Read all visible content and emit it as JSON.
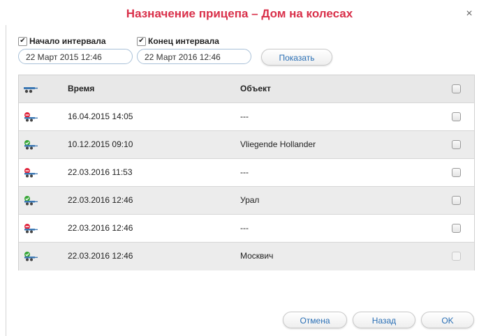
{
  "dialog": {
    "title": "Назначение прицепа – Дом на колесах",
    "close_glyph": "×"
  },
  "filters": {
    "start": {
      "label": "Начало интервала",
      "checked": true,
      "value": "22 Март 2015 12:46"
    },
    "end": {
      "label": "Конец интервала",
      "checked": true,
      "value": "22 Март 2016 12:46"
    },
    "show_label": "Показать"
  },
  "table": {
    "columns": {
      "icon": "trailer-icon",
      "time": "Время",
      "object": "Объект"
    },
    "rows": [
      {
        "status": "unassigned",
        "time": "16.04.2015 14:05",
        "object": "---"
      },
      {
        "status": "assigned",
        "time": "10.12.2015 09:10",
        "object": "Vliegende Hollander"
      },
      {
        "status": "unassigned",
        "time": "22.03.2016 11:53",
        "object": "---"
      },
      {
        "status": "assigned",
        "time": "22.03.2016 12:46",
        "object": "Урал"
      },
      {
        "status": "unassigned",
        "time": "22.03.2016 12:46",
        "object": "---"
      },
      {
        "status": "assigned",
        "time": "22.03.2016 12:46",
        "object": "Москвич"
      }
    ]
  },
  "buttons": {
    "cancel": "Отмена",
    "back": "Назад",
    "ok": "OK"
  },
  "colors": {
    "title": "#d9304a",
    "link": "#2a6fb5",
    "assigned": "#35a535",
    "unassigned": "#e0243c",
    "trailer": "#3c78b4"
  }
}
